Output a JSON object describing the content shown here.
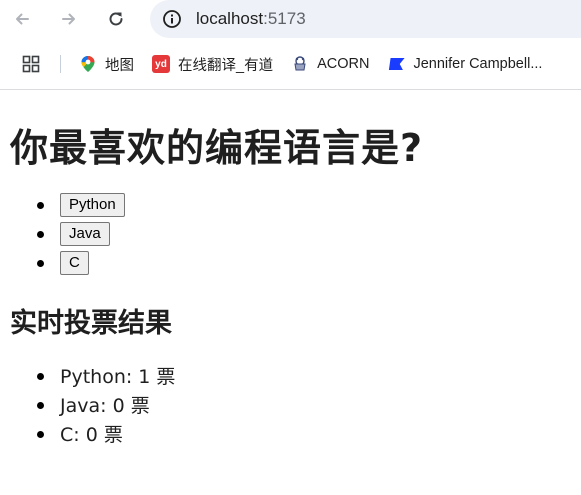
{
  "browser": {
    "url_host": "localhost",
    "url_port": ":5173",
    "bookmarks": [
      {
        "label": "地图",
        "icon": "maps-pin-icon"
      },
      {
        "label": "在线翻译_有道",
        "icon": "youdao-icon"
      },
      {
        "label": "ACORN",
        "icon": "acorn-icon"
      },
      {
        "label": "Jennifer Campbell...",
        "icon": "flag-icon"
      }
    ],
    "youdao_icon_text": "yd"
  },
  "page": {
    "title": "你最喜欢的编程语言是?",
    "options": [
      "Python",
      "Java",
      "C"
    ],
    "results_title": "实时投票结果",
    "results": [
      {
        "text": "Python: 1 票"
      },
      {
        "text": "Java: 0 票"
      },
      {
        "text": "C: 0 票"
      }
    ]
  },
  "colors": {
    "accent_blue": "#1a73e8",
    "youdao_red": "#e5383b"
  }
}
